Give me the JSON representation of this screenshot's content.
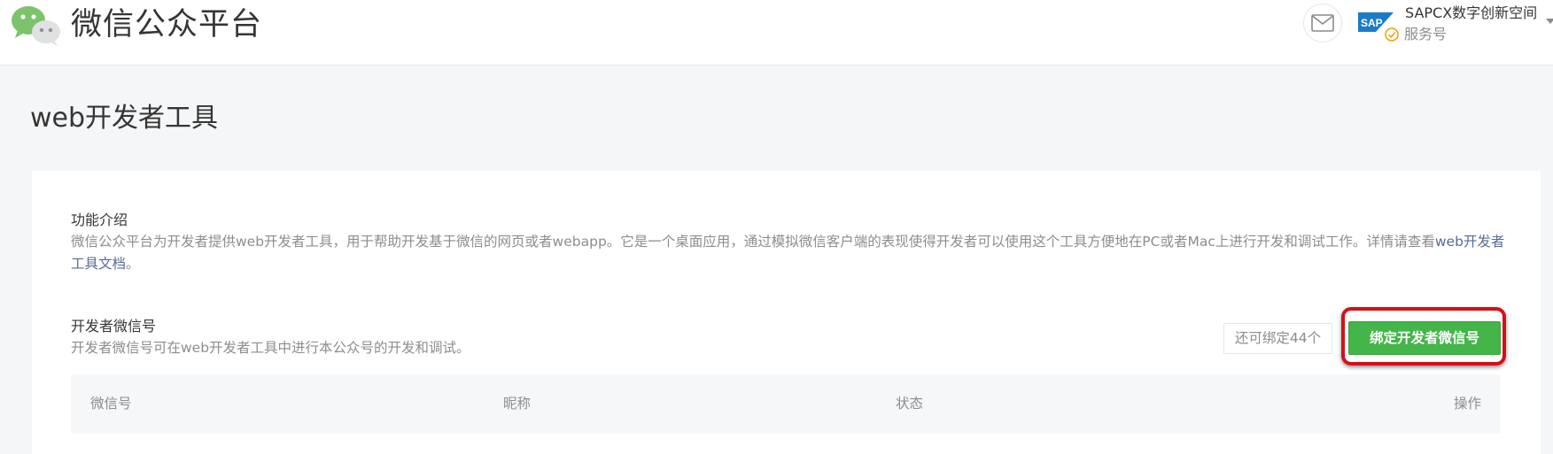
{
  "header": {
    "platform_title": "微信公众平台",
    "account_name": "SAPCX数字创新空间",
    "account_type": "服务号",
    "sap_logo_text": "SAP"
  },
  "page": {
    "title": "web开发者工具"
  },
  "intro": {
    "title": "功能介绍",
    "desc": "微信公众平台为开发者提供web开发者工具，用于帮助开发基于微信的网页或者webapp。它是一个桌面应用，通过模拟微信客户端的表现使得开发者可以使用这个工具方便地在PC或者Mac上进行开发和调试工作。详情请查看",
    "doc_link": "web开发者工具文档",
    "desc_tail": "。"
  },
  "developer": {
    "title": "开发者微信号",
    "desc": "开发者微信号可在web开发者工具中进行本公众号的开发和调试。",
    "remaining": "还可绑定44个",
    "bind_button": "绑定开发者微信号"
  },
  "table": {
    "columns": [
      "微信号",
      "昵称",
      "状态",
      "操作"
    ]
  },
  "colors": {
    "primary_green": "#44b549",
    "highlight_red": "#d0121b",
    "link_blue": "#576b95",
    "page_bg": "#f5f6f8"
  },
  "icons": {
    "logo": "wechat-logo-icon",
    "mail": "mail-icon",
    "verified": "verified-badge-icon",
    "dropdown": "chevron-down-icon"
  }
}
